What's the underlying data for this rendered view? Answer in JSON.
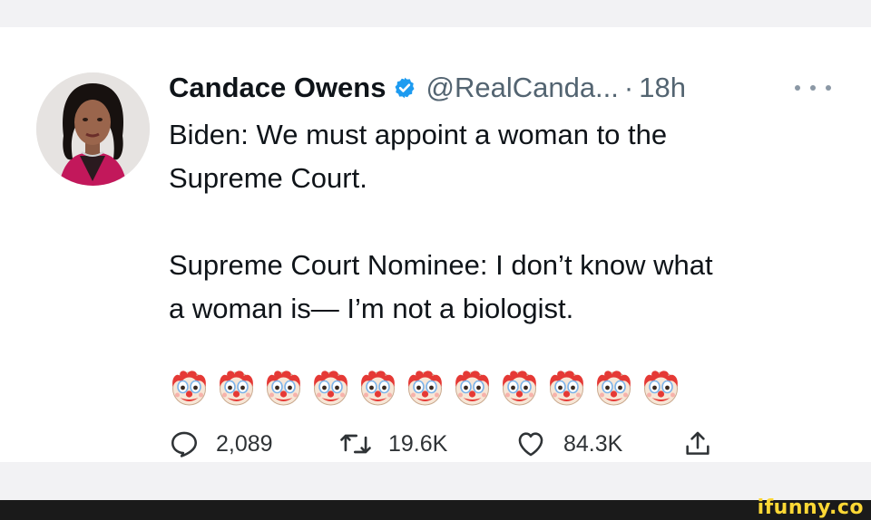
{
  "tweet": {
    "author_name": "Candace Owens",
    "handle": "@RealCanda...",
    "separator": "·",
    "timestamp": "18h",
    "text_lines": [
      "Biden: We must appoint a woman to the",
      "Supreme Court.",
      "Supreme Court Nominee: I don’t know what",
      "a woman is— I’m not a biologist."
    ],
    "emoji": "clown-face",
    "emoji_count": 11
  },
  "actions": {
    "replies": "2,089",
    "retweets": "19.6K",
    "likes": "84.3K"
  },
  "icons": {
    "verified": "verified-badge-icon",
    "more": "more-icon",
    "reply": "reply-icon",
    "retweet": "retweet-icon",
    "like": "like-icon",
    "share": "share-icon"
  },
  "watermark": "ifunny.co",
  "colors": {
    "verified": "#1d9bf0",
    "secondary_text": "#536471",
    "watermark": "#fdd835"
  }
}
